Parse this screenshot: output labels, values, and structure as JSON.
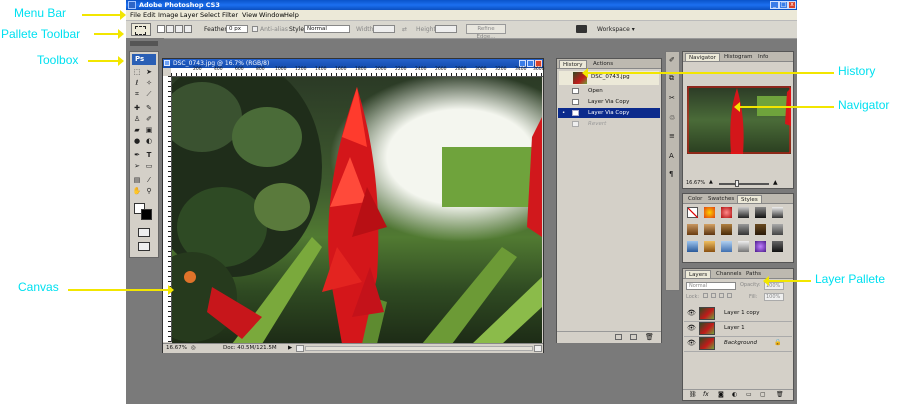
{
  "window": {
    "title": "Adobe Photoshop CS3"
  },
  "menu": [
    "File",
    "Edit",
    "Image",
    "Layer",
    "Select",
    "Filter",
    "View",
    "Window",
    "Help"
  ],
  "options": {
    "feather_label": "Feather:",
    "feather_value": "0 px",
    "antialias_label": "Anti-alias",
    "style_label": "Style:",
    "style_value": "Normal",
    "width_label": "Width:",
    "height_label": "Height:",
    "refine_label": "Refine Edge...",
    "workspace_label": "Workspace ▾"
  },
  "toolbox": {
    "logo": "Ps"
  },
  "document": {
    "title": "DSC_0743.jpg @ 16.7% (RGB/8)",
    "ruler_labels": [
      "200",
      "400",
      "600",
      "800",
      "1000",
      "1200",
      "1400",
      "1600",
      "1800",
      "2000",
      "2200",
      "2400",
      "2600",
      "2800",
      "3000",
      "3200",
      "3400",
      "3600"
    ],
    "zoom": "16.67%",
    "doc_info": "Doc: 40.5M/121.5M"
  },
  "history": {
    "tabs": [
      "History",
      "Actions"
    ],
    "snapshot": "DSC_0743.jpg",
    "items": [
      {
        "label": "Open",
        "selected": false,
        "dim": false
      },
      {
        "label": "Layer Via Copy",
        "selected": false,
        "dim": false
      },
      {
        "label": "Layer Via Copy",
        "selected": true,
        "dim": false
      },
      {
        "label": "Revert",
        "selected": false,
        "dim": true
      }
    ]
  },
  "navigator": {
    "tabs": [
      "Navigator",
      "Histogram",
      "Info"
    ],
    "zoom": "16.67%"
  },
  "styles": {
    "tabs": [
      "Color",
      "Swatches",
      "Styles"
    ]
  },
  "layers": {
    "tabs": [
      "Layers",
      "Channels",
      "Paths"
    ],
    "blend_mode": "Normal",
    "opacity_label": "Opacity:",
    "opacity_value": "100%",
    "lock_label": "Lock:",
    "fill_label": "Fill:",
    "fill_value": "100%",
    "items": [
      "Layer 1 copy",
      "Layer 1",
      "Background"
    ]
  },
  "annotations": {
    "menu_bar": "Menu Bar",
    "palette_toolbar": "Pallete Toolbar",
    "toolbox": "Toolbox",
    "canvas": "Canvas",
    "history": "History",
    "navigator": "Navigator",
    "layer_palette": "Layer Pallete"
  },
  "colors": {
    "annotation_text": "#00e0f0",
    "annotation_arrow": "#f2e600",
    "titlebar": "#0a53c9",
    "history_selected": "#0b2a8c"
  }
}
